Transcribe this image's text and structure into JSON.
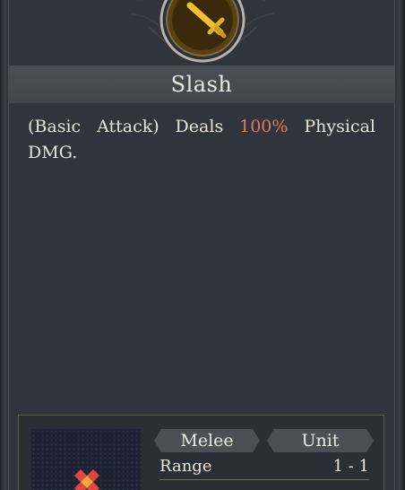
{
  "skill": {
    "name": "Slash",
    "icon": "sword-icon",
    "description": {
      "prefix": "(Basic Attack) Deals ",
      "value": "100%",
      "suffix": " Physical DMG."
    }
  },
  "details": {
    "tags": [
      "Melee",
      "Unit"
    ],
    "stats": [
      {
        "label": "Range",
        "value": "1 - 1"
      }
    ]
  },
  "colors": {
    "highlight": "#e07a5a",
    "emblem_gold": "#d8a51e",
    "text": "#ece8df"
  }
}
